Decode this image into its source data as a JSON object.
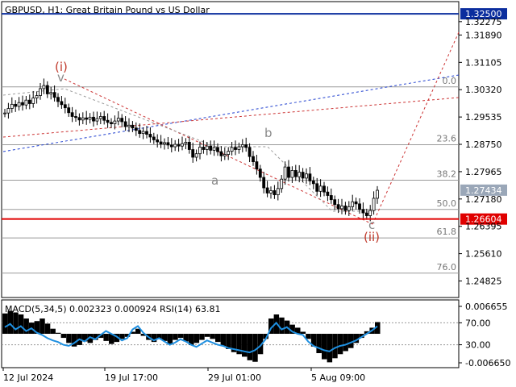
{
  "header": {
    "title": "GBPUSD, H1:  Great Britain Pound vs US Dollar",
    "indicator_label": "MACD(5,34,5) 0.002323 0.000924 RSI(14) 63.81"
  },
  "colors": {
    "background": "#ffffff",
    "candles": "#000000",
    "blue_level": "#0b2e9e",
    "red_level": "#e00000",
    "red_label_bg": "#e00000",
    "current_price_label_bg": "#9aa7b8",
    "rsi": "#1e8fe0",
    "channel_blue": "#1f3fcf",
    "channel_red": "#cc3333"
  },
  "chart_data": [
    {
      "type": "line",
      "subtype": "candlestick",
      "symbol": "GBPUSD",
      "timeframe": "H1",
      "y_ticks": [
        "1.32275",
        "1.31890",
        "1.31105",
        "1.30320",
        "1.29535",
        "1.28750",
        "1.27965",
        "1.27180",
        "1.26395",
        "1.25610",
        "1.24825"
      ],
      "ylim": [
        1.2435,
        1.3285
      ],
      "x_tick_labels": [
        "12 Jul 2024",
        "19 Jul 17:00",
        "29 Jul 01:00",
        "5 Aug 09:00"
      ],
      "price_series": [
        1.2965,
        1.2978,
        1.299,
        1.2984,
        1.2995,
        1.2988,
        1.3002,
        1.2992,
        1.3008,
        1.3015,
        1.3035,
        1.3044,
        1.302,
        1.3024,
        1.301,
        1.2998,
        1.2989,
        1.298,
        1.2966,
        1.2955,
        1.2952,
        1.2945,
        1.2951,
        1.2947,
        1.2953,
        1.2942,
        1.2949,
        1.2955,
        1.2944,
        1.2938,
        1.2934,
        1.2942,
        1.295,
        1.294,
        1.2926,
        1.293,
        1.2922,
        1.2915,
        1.2906,
        1.2912,
        1.2904,
        1.2896,
        1.2888,
        1.2882,
        1.2876,
        1.288,
        1.2873,
        1.2868,
        1.2875,
        1.287,
        1.2877,
        1.2881,
        1.286,
        1.2838,
        1.2848,
        1.2867,
        1.286,
        1.287,
        1.2858,
        1.2866,
        1.2854,
        1.2842,
        1.2846,
        1.2855,
        1.2866,
        1.286,
        1.2868,
        1.2874,
        1.2866,
        1.284,
        1.2825,
        1.2804,
        1.278,
        1.275,
        1.2735,
        1.2742,
        1.273,
        1.2748,
        1.2775,
        1.281,
        1.278,
        1.28,
        1.2782,
        1.2795,
        1.2778,
        1.279,
        1.277,
        1.2762,
        1.274,
        1.2755,
        1.2738,
        1.2728,
        1.2716,
        1.2702,
        1.269,
        1.2698,
        1.2685,
        1.2696,
        1.271,
        1.2704,
        1.2688,
        1.2678,
        1.267,
        1.2685,
        1.272,
        1.2743
      ],
      "levels": [
        {
          "label": "1.32500",
          "value": 1.325,
          "color": "#0b2e9e"
        },
        {
          "label": "1.26604",
          "value": 1.26604,
          "color": "#e00000"
        }
      ],
      "current_price_label": "1.27434",
      "current_price": 1.27434,
      "fibonacci": [
        {
          "label": "0.0",
          "value": 1.304
        },
        {
          "label": "23.6",
          "value": 1.2874
        },
        {
          "label": "38.2",
          "value": 1.2772
        },
        {
          "label": "50.0",
          "value": 1.2688
        },
        {
          "label": "61.8",
          "value": 1.2606
        },
        {
          "label": "76.0",
          "value": 1.2505
        }
      ],
      "wave_labels": [
        {
          "text": "(i)",
          "style": "red"
        },
        {
          "text": "v",
          "style": "grey"
        },
        {
          "text": "a",
          "style": "grey"
        },
        {
          "text": "b",
          "style": "grey"
        },
        {
          "text": "c",
          "style": "grey"
        },
        {
          "text": "(ii)",
          "style": "red"
        }
      ]
    },
    {
      "type": "bar",
      "subtype": "macd-rsi",
      "y_ticks": [
        "0.006655",
        "70.00",
        "30.00",
        "-0.006650"
      ],
      "ylim": [
        -0.00665,
        0.006655
      ],
      "rsi_levels": [
        70,
        30
      ],
      "macd_histogram": [
        0.004,
        0.0045,
        0.0042,
        0.0038,
        0.003,
        0.0022,
        0.0025,
        0.003,
        0.002,
        0.001,
        0.0002,
        -0.0008,
        -0.0018,
        -0.0025,
        -0.0022,
        -0.0015,
        -0.0018,
        -0.0012,
        -0.0008,
        -0.0014,
        -0.002,
        -0.0016,
        -0.001,
        -0.0006,
        0.0004,
        0.001,
        -0.0004,
        -0.0012,
        -0.0016,
        -0.001,
        -0.0014,
        -0.002,
        -0.0012,
        -0.0008,
        -0.0015,
        -0.0022,
        -0.0018,
        -0.0012,
        -0.0006,
        -0.001,
        -0.0016,
        -0.0024,
        -0.003,
        -0.0036,
        -0.004,
        -0.0045,
        -0.0052,
        -0.0055,
        -0.004,
        -0.001,
        0.003,
        0.0038,
        0.0032,
        0.0026,
        0.0018,
        0.0012,
        0.0004,
        -0.001,
        -0.0025,
        -0.0038,
        -0.005,
        -0.0056,
        -0.0048,
        -0.004,
        -0.0034,
        -0.0028,
        -0.0018,
        -0.0008,
        0.0005,
        0.0012,
        0.0023
      ],
      "rsi": [
        62,
        68,
        58,
        64,
        55,
        60,
        52,
        48,
        42,
        38,
        35,
        30,
        28,
        33,
        40,
        36,
        44,
        40,
        48,
        55,
        50,
        45,
        38,
        42,
        58,
        64,
        52,
        44,
        38,
        42,
        36,
        30,
        34,
        40,
        36,
        30,
        26,
        32,
        38,
        34,
        30,
        28,
        24,
        22,
        20,
        18,
        16,
        20,
        28,
        40,
        60,
        70,
        58,
        62,
        54,
        50,
        48,
        36,
        28,
        24,
        20,
        18,
        24,
        28,
        30,
        34,
        38,
        44,
        50,
        56,
        63.81
      ]
    }
  ]
}
